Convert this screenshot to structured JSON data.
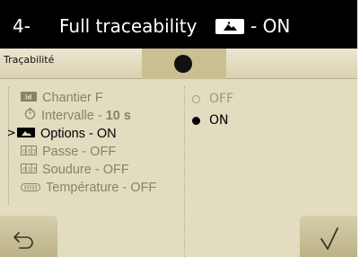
{
  "header": {
    "step_number": "4-",
    "title": "Full traceability",
    "mode_icon": "options-icon",
    "status": "- ON"
  },
  "subheader": {
    "label": "Traçabilité",
    "tab_icon": "dot-indicator"
  },
  "menu": {
    "items": [
      {
        "icon": "id-badge-icon",
        "text": "Chantier F",
        "value": "",
        "active": false
      },
      {
        "icon": "timer-icon",
        "text": "Intervalle - ",
        "value": "10 s",
        "active": false
      },
      {
        "icon": "options-icon",
        "text": "Options - ON",
        "value": "",
        "active": true
      },
      {
        "icon": "counter-icon",
        "text": "Passe - OFF",
        "value": "",
        "active": false
      },
      {
        "icon": "counter-icon",
        "text": "Soudure - OFF",
        "value": "",
        "active": false
      },
      {
        "icon": "temperature-strip-icon",
        "text": "Température - OFF",
        "value": "",
        "active": false
      }
    ]
  },
  "options": [
    {
      "label": "OFF",
      "selected": false
    },
    {
      "label": "ON",
      "selected": true
    }
  ],
  "footer": {
    "back_icon": "back-arrow-icon",
    "confirm_icon": "checkmark-icon"
  },
  "colors": {
    "background": "#e2dcc0",
    "titlebar": "#000000",
    "muted_text": "#8a8462",
    "button": "#c9bf92"
  }
}
